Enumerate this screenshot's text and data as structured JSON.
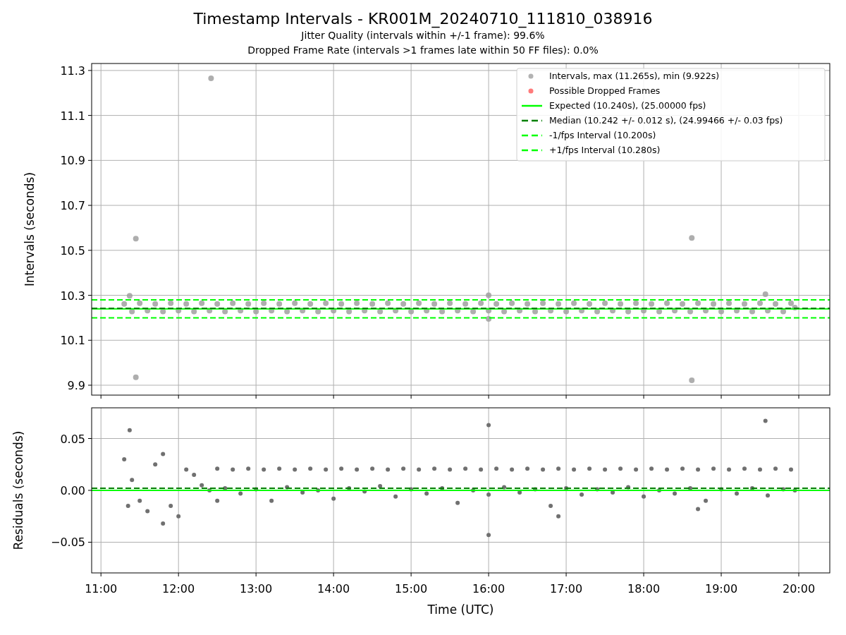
{
  "title": "Timestamp Intervals - KR001M_20240710_111810_038916",
  "subtitles": [
    "Jitter Quality (intervals within +/-1 frame): 99.6%",
    "Dropped Frame Rate (intervals >1 frames late within 50 FF files): 0.0%"
  ],
  "charts": [
    {
      "chart_data": {
        "type": "scatter",
        "ylabel": "Intervals (seconds)",
        "xlim": [
          10.88,
          20.4
        ],
        "ylim": [
          9.856,
          11.331
        ],
        "grid": true,
        "legend": "upper right",
        "yticks": [
          {
            "value": 9.9,
            "label": "9.9"
          },
          {
            "value": 10.1,
            "label": "10.1"
          },
          {
            "value": 10.3,
            "label": "10.3"
          },
          {
            "value": 10.5,
            "label": "10.5"
          },
          {
            "value": 10.7,
            "label": "10.7"
          },
          {
            "value": 10.9,
            "label": "10.9"
          },
          {
            "value": 11.1,
            "label": "11.1"
          },
          {
            "value": 11.3,
            "label": "11.3"
          }
        ],
        "series": [
          {
            "name": "Intervals, max (11.265s), min (9.922s)",
            "color": "#a0a0a0",
            "x": [
              11.3,
              11.5,
              11.7,
              11.9,
              12.1,
              12.3,
              12.5,
              12.7,
              12.9,
              13.1,
              13.3,
              13.5,
              13.7,
              13.9,
              14.1,
              14.3,
              14.5,
              14.7,
              14.9,
              15.1,
              15.3,
              15.5,
              15.7,
              15.9,
              16.1,
              16.3,
              16.5,
              16.7,
              16.9,
              17.1,
              17.3,
              17.5,
              17.7,
              17.9,
              18.1,
              18.3,
              18.5,
              18.7,
              18.9,
              19.1,
              19.3,
              19.5,
              19.7,
              19.9,
              11.4,
              11.6,
              11.8,
              12.0,
              12.2,
              12.4,
              12.6,
              12.8,
              13.0,
              13.2,
              13.4,
              13.6,
              13.8,
              14.0,
              14.2,
              14.4,
              14.6,
              14.8,
              15.0,
              15.2,
              15.4,
              15.6,
              15.8,
              16.0,
              16.2,
              16.4,
              16.6,
              16.8,
              17.0,
              17.2,
              17.4,
              17.6,
              17.8,
              18.0,
              18.2,
              18.4,
              18.6,
              18.8,
              19.0,
              19.2,
              19.4,
              19.6,
              19.8,
              19.95,
              11.37,
              11.45,
              11.45,
              12.42,
              16.0,
              16.0,
              18.62,
              18.62,
              19.57
            ],
            "values": [
              10.262,
              10.265,
              10.262,
              10.265,
              10.262,
              10.265,
              10.262,
              10.265,
              10.262,
              10.265,
              10.262,
              10.265,
              10.262,
              10.265,
              10.262,
              10.265,
              10.262,
              10.265,
              10.262,
              10.265,
              10.262,
              10.265,
              10.262,
              10.265,
              10.262,
              10.265,
              10.262,
              10.265,
              10.262,
              10.265,
              10.262,
              10.265,
              10.262,
              10.265,
              10.262,
              10.265,
              10.262,
              10.265,
              10.262,
              10.265,
              10.262,
              10.265,
              10.262,
              10.265,
              10.228,
              10.232,
              10.228,
              10.232,
              10.228,
              10.232,
              10.228,
              10.232,
              10.228,
              10.232,
              10.228,
              10.232,
              10.228,
              10.232,
              10.228,
              10.232,
              10.228,
              10.232,
              10.228,
              10.232,
              10.228,
              10.232,
              10.228,
              10.232,
              10.228,
              10.232,
              10.228,
              10.232,
              10.228,
              10.232,
              10.228,
              10.232,
              10.228,
              10.232,
              10.228,
              10.232,
              10.228,
              10.232,
              10.228,
              10.232,
              10.228,
              10.232,
              10.228,
              10.245,
              10.298,
              10.552,
              9.935,
              11.265,
              10.3,
              10.195,
              10.555,
              9.922,
              10.305
            ]
          },
          {
            "name": "Possible Dropped Frames",
            "color": "#ff5a5a"
          }
        ],
        "ref_lines": [
          {
            "label": "Expected (10.240s), (25.00000 fps)",
            "axis": "y",
            "value": 10.24,
            "color": "#00ff00"
          },
          {
            "label": "Median (10.242 +/- 0.012 s), (24.99466 +/- 0.03 fps)",
            "axis": "y",
            "value": 10.242,
            "color": "#008000"
          },
          {
            "label": "-1/fps Interval (10.200s)",
            "axis": "y",
            "value": 10.2,
            "color": "#00ff00"
          },
          {
            "label": "+1/fps Interval (10.280s)",
            "axis": "y",
            "value": 10.28,
            "color": "#00ff00"
          }
        ]
      }
    },
    {
      "chart_data": {
        "type": "scatter",
        "xlabel": "Time (UTC)",
        "ylabel": "Residuals (seconds)",
        "xlim": [
          10.88,
          20.4
        ],
        "ylim": [
          -0.0796,
          0.0796
        ],
        "xticks": [
          {
            "value": 11,
            "label": "11:00"
          },
          {
            "value": 12,
            "label": "12:00"
          },
          {
            "value": 13,
            "label": "13:00"
          },
          {
            "value": 14,
            "label": "14:00"
          },
          {
            "value": 15,
            "label": "15:00"
          },
          {
            "value": 16,
            "label": "16:00"
          },
          {
            "value": 17,
            "label": "17:00"
          },
          {
            "value": 18,
            "label": "18:00"
          },
          {
            "value": 19,
            "label": "19:00"
          },
          {
            "value": 20,
            "label": "20:00"
          }
        ],
        "yticks": [
          {
            "value": -0.05,
            "label": "−0.05"
          },
          {
            "value": 0,
            "label": "0.00"
          },
          {
            "value": 0.05,
            "label": "0.05"
          }
        ],
        "series": [
          {
            "color": "#707070",
            "x": [
              11.3,
              11.5,
              11.7,
              11.9,
              12.1,
              12.3,
              12.5,
              12.7,
              12.9,
              13.1,
              13.3,
              13.5,
              13.7,
              13.9,
              14.1,
              14.3,
              14.5,
              14.7,
              14.9,
              15.1,
              15.3,
              15.5,
              15.7,
              15.9,
              16.1,
              16.3,
              16.5,
              16.7,
              16.9,
              17.1,
              17.3,
              17.5,
              17.7,
              17.9,
              18.1,
              18.3,
              18.5,
              18.7,
              18.9,
              19.1,
              19.3,
              19.5,
              19.7,
              19.9,
              11.4,
              11.6,
              11.8,
              12.0,
              12.2,
              12.4,
              12.6,
              12.8,
              13.0,
              13.2,
              13.4,
              13.6,
              13.8,
              14.0,
              14.2,
              14.4,
              14.6,
              14.8,
              15.0,
              15.2,
              15.4,
              15.6,
              15.8,
              16.0,
              16.2,
              16.4,
              16.6,
              16.8,
              17.0,
              17.2,
              17.4,
              17.6,
              17.8,
              18.0,
              18.2,
              18.4,
              18.6,
              18.8,
              19.0,
              19.2,
              19.4,
              19.6,
              19.8,
              19.95,
              11.37,
              16.0,
              16.0,
              19.57,
              11.8,
              11.35,
              12.5,
              16.9,
              18.7
            ],
            "values": [
              0.03,
              -0.01,
              0.025,
              -0.015,
              0.02,
              0.005,
              0.021,
              0.02,
              0.021,
              0.02,
              0.021,
              0.02,
              0.021,
              0.02,
              0.021,
              0.02,
              0.021,
              0.02,
              0.021,
              0.02,
              0.021,
              0.02,
              0.021,
              0.02,
              0.021,
              0.02,
              0.021,
              0.02,
              0.021,
              0.02,
              0.021,
              0.02,
              0.021,
              0.02,
              0.021,
              0.02,
              0.021,
              0.02,
              0.021,
              0.02,
              0.021,
              0.02,
              0.021,
              0.02,
              0.01,
              -0.02,
              0.035,
              -0.025,
              0.015,
              0.0,
              0.002,
              -0.003,
              0.001,
              -0.01,
              0.003,
              -0.002,
              0.0,
              -0.008,
              0.002,
              -0.001,
              0.004,
              -0.006,
              0.001,
              -0.003,
              0.002,
              -0.012,
              0.0,
              -0.004,
              0.003,
              -0.002,
              0.001,
              -0.015,
              0.002,
              -0.004,
              0.001,
              -0.002,
              0.003,
              -0.006,
              0.0,
              -0.003,
              0.002,
              -0.01,
              0.001,
              -0.003,
              0.002,
              -0.005,
              0.001,
              0.0,
              0.058,
              0.063,
              -0.043,
              0.067,
              -0.032,
              -0.015,
              -0.01,
              -0.025,
              -0.018
            ]
          }
        ],
        "grid": true,
        "ref_lines": [
          {
            "axis": "y",
            "value": 0,
            "color": "#00ff00"
          },
          {
            "axis": "y",
            "value": 0.002,
            "color": "#008000"
          }
        ]
      }
    }
  ]
}
